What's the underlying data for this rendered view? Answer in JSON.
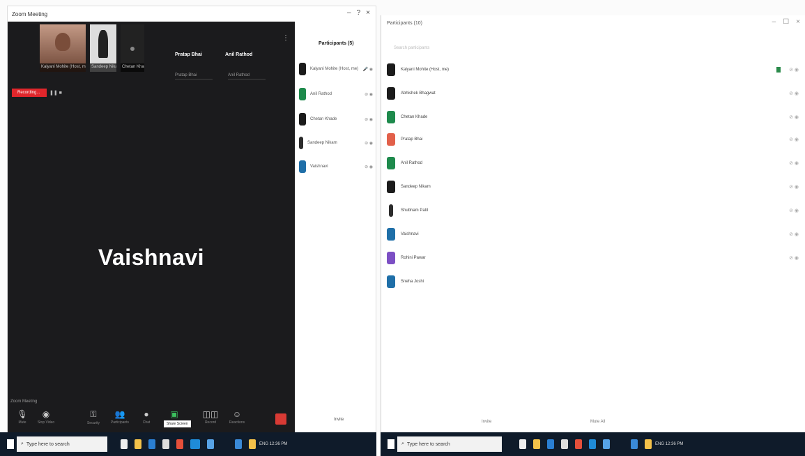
{
  "left_window": {
    "title": "Zoom Meeting",
    "controls": [
      "–",
      "?",
      "×"
    ],
    "thumbnails": [
      {
        "caption": "Kalyani Mohite (Host, me)"
      },
      {
        "caption": "Sandeep Nikam"
      },
      {
        "caption": "Chetan Khade"
      }
    ],
    "name_chips": [
      "Pratap Bhai",
      "Anil Rathod"
    ],
    "name_sub": [
      "Pratap Bhai",
      "Anil Rathod"
    ],
    "menu": "⋮",
    "recording_label": "Recording...",
    "recording_extra": "❚❚ ■",
    "speaker": "Vaishnavi",
    "toolbar": {
      "top_label": "Zoom Meeting",
      "items": [
        {
          "icon": "mic-icon",
          "glyph": "🎙",
          "label": "Mute"
        },
        {
          "icon": "video-icon",
          "glyph": "◉",
          "label": "Stop Video"
        },
        {
          "icon": "security-icon",
          "glyph": "⚿",
          "label": "Security"
        },
        {
          "icon": "participants-icon",
          "glyph": "👥",
          "label": "Participants"
        },
        {
          "icon": "chat-icon",
          "glyph": "●",
          "label": "Chat"
        },
        {
          "icon": "share-icon",
          "glyph": "▣",
          "label": "Share Screen"
        },
        {
          "icon": "record-icon",
          "glyph": "◫◫",
          "label": "Record"
        },
        {
          "icon": "reactions-icon",
          "glyph": "☺",
          "label": "Reactions"
        }
      ],
      "tooltip": "Share Screen"
    },
    "participants_panel": {
      "title": "Participants (5)",
      "rows": [
        {
          "name": "Kalyani Mohite (Host, me)",
          "right": "🎤 ◉",
          "color": "#1b1b1b"
        },
        {
          "name": "Anil Rathod",
          "right": "⊘ ◉",
          "color": "#1e8a4c"
        },
        {
          "name": "Chetan Khade",
          "right": "⊘ ◉",
          "color": "#1b1b1b"
        },
        {
          "name": "Sandeep Nikam",
          "right": "⊘ ◉",
          "color": "#2c2c2c"
        },
        {
          "name": "Vaishnavi",
          "right": "⊘ ◉",
          "color": "#1f6fa8"
        }
      ],
      "footer": "Invite"
    }
  },
  "right_window": {
    "title": "Participants (10)",
    "controls": [
      "–",
      "☐",
      "×"
    ],
    "subtitle": "Search participants",
    "rows": [
      {
        "name": "Kalyani Mohite (Host, me)",
        "right": "⊘ ◉",
        "color": "#1b1b1b"
      },
      {
        "name": "Abhishek Bhagwat",
        "right": "⊘ ◉",
        "color": "#1b1b1b"
      },
      {
        "name": "Chetan Khade",
        "right": "⊘ ◉",
        "color": "#1e8a4c"
      },
      {
        "name": "Pratap Bhai",
        "right": "⊘ ◉",
        "color": "#e2604a"
      },
      {
        "name": "Anil Rathod",
        "right": "⊘ ◉",
        "color": "#1e8a4c"
      },
      {
        "name": "Sandeep Nikam",
        "right": "⊘ ◉",
        "color": "#1b1b1b"
      },
      {
        "name": "Shubham Patil",
        "right": "⊘ ◉",
        "color": "#2c2c2c"
      },
      {
        "name": "Vaishnavi",
        "right": "⊘ ◉",
        "color": "#1f6fa8"
      },
      {
        "name": "Rohini Pawar",
        "right": "⊘ ◉",
        "color": "#7c4fc4"
      },
      {
        "name": "Sneha Joshi",
        "right": "",
        "color": "#1f6fa8"
      }
    ],
    "footer_left": "Invite",
    "footer_right": "Mute All"
  },
  "taskbar_left": {
    "search_placeholder": "Type here to search",
    "tray": "ENG 12:36 PM"
  },
  "taskbar_right": {
    "search_placeholder": "Type here to search",
    "tray": "ENG 12:36 PM"
  }
}
